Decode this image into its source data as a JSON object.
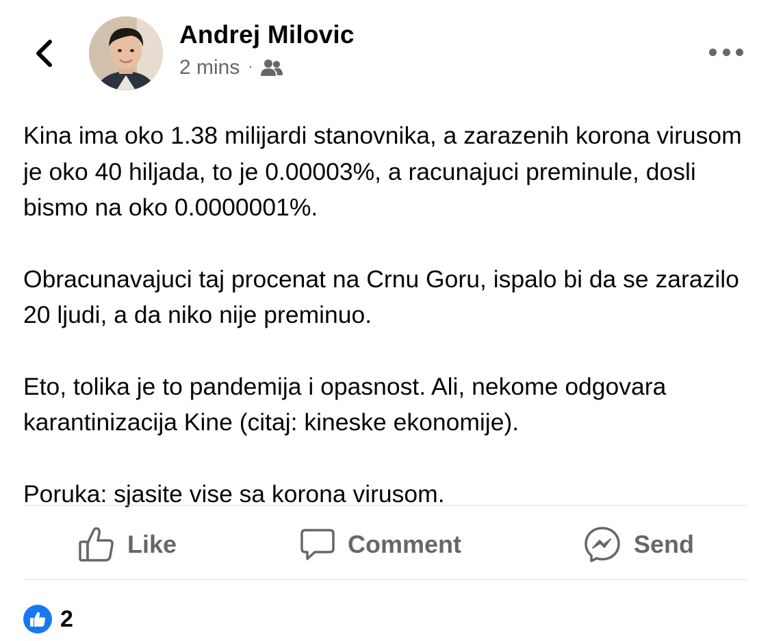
{
  "header": {
    "author_name": "Andrej Milovic",
    "timestamp": "2 mins",
    "separator": "·",
    "audience_icon": "friends-icon",
    "back_icon": "chevron-left-icon",
    "more_icon": "more-horizontal-icon"
  },
  "post": {
    "paragraphs": [
      "Kina ima oko 1.38 milijardi stanovnika, a zarazenih korona virusom je oko 40 hiljada, to je 0.00003%, a racunajuci preminule, dosli bismo na oko 0.0000001%.",
      "Obracunavajuci taj procenat na Crnu Goru, ispalo bi da se zarazilo 20 ljudi, a da niko nije preminuo.",
      "Eto, tolika je to pandemija i opasnost. Ali, nekome odgovara karantinizacija Kine (citaj: kineske ekonomije).",
      "Poruka: sjasite vise sa korona virusom."
    ]
  },
  "actions": {
    "like_label": "Like",
    "comment_label": "Comment",
    "send_label": "Send"
  },
  "reactions": {
    "count": "2",
    "icon": "like-reaction-icon"
  },
  "colors": {
    "text_primary": "#050505",
    "text_secondary": "#65676b",
    "divider": "#dadde1",
    "brand_blue": "#1877f2"
  }
}
